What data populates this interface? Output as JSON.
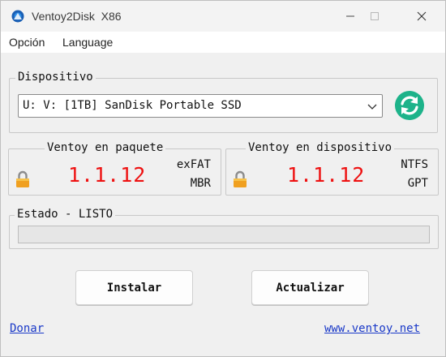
{
  "window": {
    "title": "Ventoy2Disk  X86",
    "minimize_icon": "minimize-icon",
    "maximize_icon": "maximize-icon",
    "close_icon": "close-icon"
  },
  "menu": {
    "items": [
      {
        "label": "Opción"
      },
      {
        "label": "Language"
      }
    ]
  },
  "device": {
    "group_label": "Dispositivo",
    "selected": "U: V: [1TB] SanDisk Portable SSD",
    "refresh_icon": "refresh-icon"
  },
  "package": {
    "group_label": "Ventoy en paquete",
    "version": "1.1.12",
    "filesystem": "exFAT",
    "partition_style": "MBR",
    "lock_icon": "lock-icon"
  },
  "on_device": {
    "group_label": "Ventoy en dispositivo",
    "version": "1.1.12",
    "filesystem": "NTFS",
    "partition_style": "GPT",
    "lock_icon": "lock-icon"
  },
  "status": {
    "label": "Estado - LISTO",
    "progress": 0
  },
  "actions": {
    "install_label": "Instalar",
    "update_label": "Actualizar"
  },
  "links": {
    "donate": "Donar",
    "website": "www.ventoy.net"
  },
  "colors": {
    "version_red": "#ee1111",
    "link_blue": "#1a39c8",
    "refresh_teal": "#1db38a",
    "lock_orange": "#f0a020"
  }
}
